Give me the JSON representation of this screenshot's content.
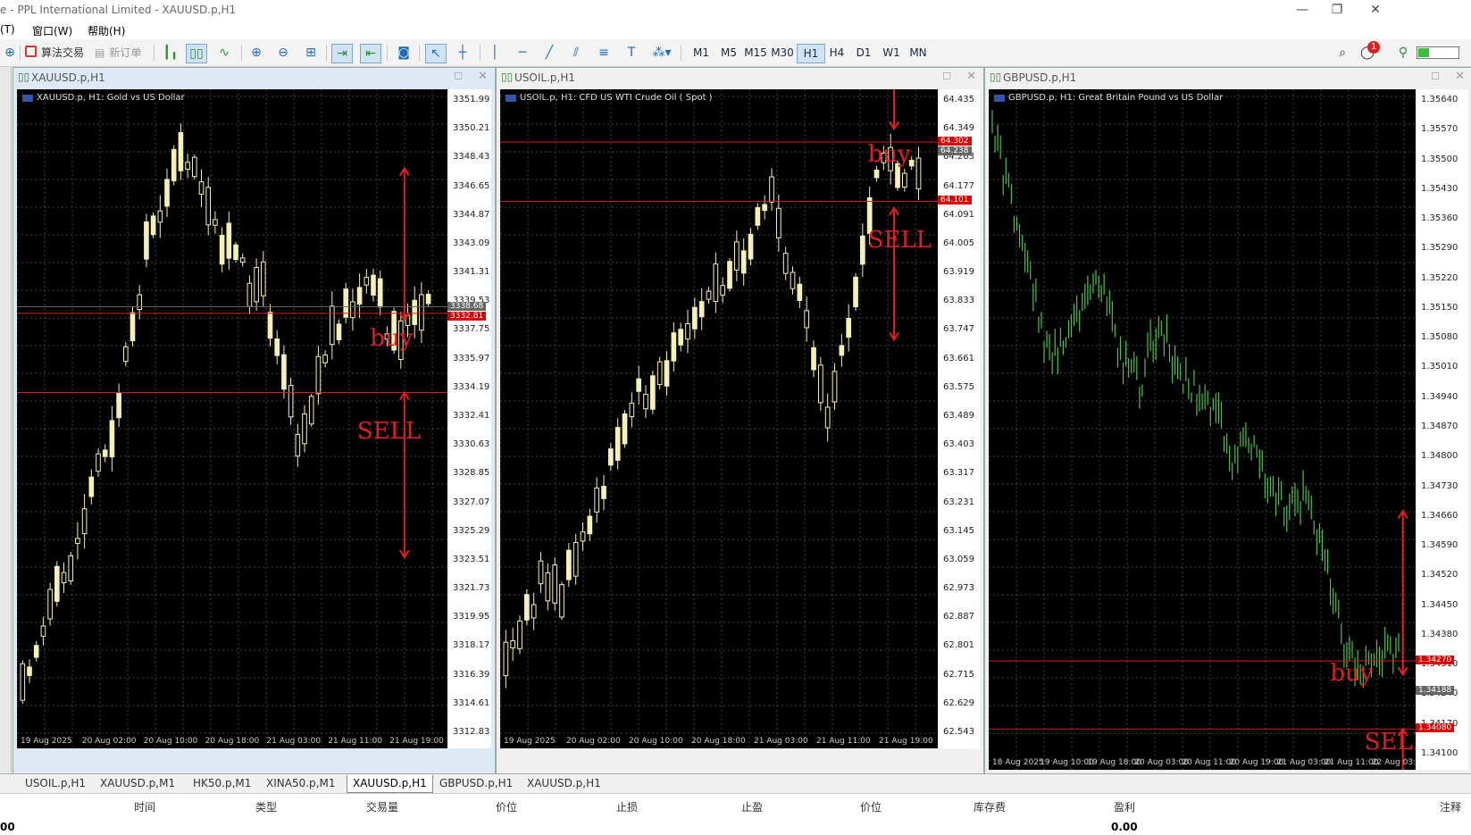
{
  "title": "e - PPL International Limited - XAUUSD.p,H1",
  "window_controls": [
    "—",
    "❐",
    "✕"
  ],
  "menu": [
    "(T)",
    "窗口(W)",
    "帮助(H)"
  ],
  "toolbar": {
    "algo_label": "算法交易",
    "new_order_label": "新订单",
    "timeframes": [
      "M1",
      "M5",
      "M15",
      "M30",
      "H1",
      "H4",
      "D1",
      "W1",
      "MN"
    ],
    "selected_timeframe": "H1",
    "notif_count": "1"
  },
  "charts": [
    {
      "title": "XAUUSD.p,H1",
      "label": "XAUUSD.p, H1:  Gold vs US Dollar",
      "active": true,
      "axis_labels": [
        "3351.99",
        "3350.21",
        "3348.43",
        "3346.65",
        "3344.87",
        "3343.09",
        "3341.31",
        "3339.53",
        "3337.75",
        "3335.97",
        "3334.19",
        "3332.41",
        "3330.63",
        "3328.85",
        "3327.07",
        "3325.29",
        "3323.51",
        "3321.73",
        "3319.95",
        "3318.17",
        "3316.39",
        "3314.61",
        "3312.83"
      ],
      "price_tags": [
        {
          "text": "3338.68",
          "color": "#666"
        },
        {
          "text": "3332.81",
          "color": "#d00"
        }
      ],
      "time_labels": [
        "19 Aug 2025",
        "20 Aug 02:00",
        "20 Aug 10:00",
        "20 Aug 18:00",
        "21 Aug 03:00",
        "21 Aug 11:00",
        "21 Aug 19:00"
      ],
      "annotations": [
        "buy",
        "SELL"
      ]
    },
    {
      "title": "USOIL.p,H1",
      "label": "USOIL.p, H1:  CFD US WTI Crude Oil ( Spot )",
      "active": false,
      "axis_labels": [
        "64.435",
        "64.349",
        "64.263",
        "64.177",
        "64.091",
        "64.005",
        "63.919",
        "63.833",
        "63.747",
        "63.661",
        "63.575",
        "63.489",
        "63.403",
        "63.317",
        "63.231",
        "63.145",
        "63.059",
        "62.973",
        "62.887",
        "62.801",
        "62.715",
        "62.629",
        "62.543"
      ],
      "price_tags": [
        {
          "text": "64.302",
          "color": "#d00"
        },
        {
          "text": "64.238",
          "color": "#666"
        },
        {
          "text": "64.101",
          "color": "#d00"
        }
      ],
      "time_labels": [
        "19 Aug 2025",
        "20 Aug 02:00",
        "20 Aug 10:00",
        "20 Aug 18:00",
        "21 Aug 03:00",
        "21 Aug 11:00",
        "21 Aug 19:00"
      ],
      "annotations": [
        "buy",
        "SELL"
      ]
    },
    {
      "title": "GBPUSD.p,H1",
      "label": "GBPUSD.p, H1:  Great Britain Pound vs US Dollar",
      "active": false,
      "axis_labels": [
        "1.35640",
        "1.35570",
        "1.35500",
        "1.35430",
        "1.35360",
        "1.35290",
        "1.35220",
        "1.35150",
        "1.35080",
        "1.35010",
        "1.34940",
        "1.34870",
        "1.34800",
        "1.34730",
        "1.34660",
        "1.34590",
        "1.34520",
        "1.34450",
        "1.34380",
        "1.34310",
        "1.34240",
        "1.34170",
        "1.34100"
      ],
      "price_tags": [
        {
          "text": "1.34270",
          "color": "#d00"
        },
        {
          "text": "1.34188",
          "color": "#666"
        },
        {
          "text": "1.34080",
          "color": "#d00"
        }
      ],
      "time_labels": [
        "18 Aug 2025",
        "19 Aug 10:00",
        "19 Aug 18:00",
        "20 Aug 03:00",
        "20 Aug 11:00",
        "20 Aug 19:00",
        "21 Aug 03:00",
        "21 Aug 11:00",
        "22 Aug 03:00"
      ],
      "annotations": [
        "buy",
        "SELL"
      ]
    }
  ],
  "tabs": [
    "USOIL.p,H1",
    "XAUUSD.p,M1",
    "HK50.p,M1",
    "XINA50.p,M1",
    "XAUUSD.p,H1",
    "GBPUSD.p,H1",
    "XAUUSD.p,H1"
  ],
  "active_tab": 4,
  "terminal": {
    "headers": [
      "时间",
      "类型",
      "交易量",
      "价位",
      "止损",
      "止盈",
      "价位",
      "库存费",
      "盈利",
      "注释"
    ],
    "left_value": "00",
    "profit": "0.00"
  },
  "colors": {
    "bull": "#f7f0b6",
    "bear": "#f7f0b6",
    "gbp": "#4fbf4f",
    "grid": "#555555",
    "red": "#e02020"
  }
}
